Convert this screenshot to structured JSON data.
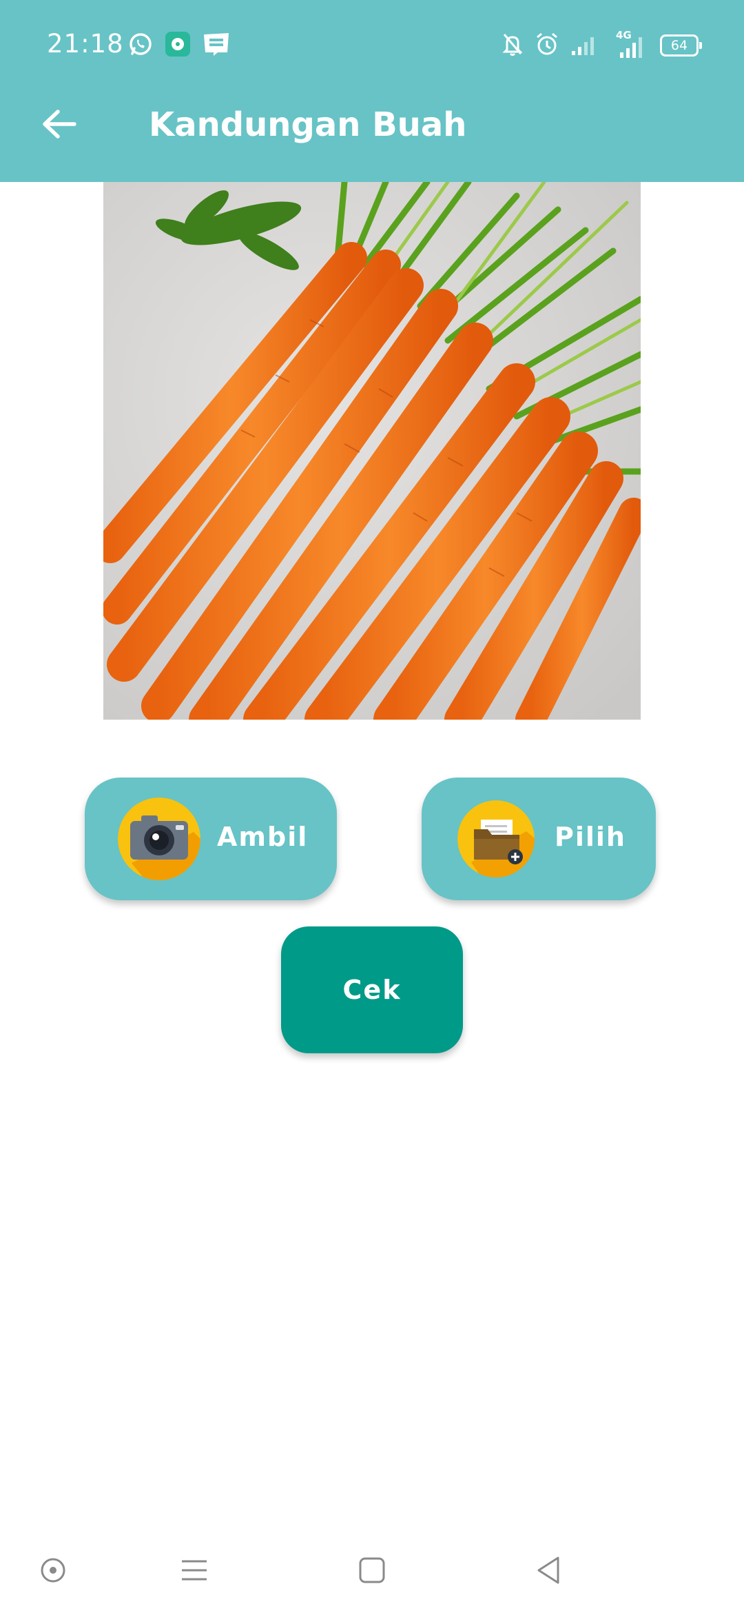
{
  "status_bar": {
    "time": "21:18",
    "network_label": "4G",
    "battery_level": "64",
    "left_icons": [
      "whatsapp-icon",
      "chat-app-icon",
      "webtoon-icon"
    ],
    "right_icons": [
      "notifications-off-icon",
      "alarm-icon",
      "signal-icon",
      "signal-4g-icon",
      "battery-icon"
    ]
  },
  "app_bar": {
    "title": "Kandungan Buah",
    "back_icon": "arrow-left-icon"
  },
  "image": {
    "subject": "carrots-photo"
  },
  "actions": {
    "ambil_label": "Ambil",
    "ambil_icon": "camera-icon",
    "pilih_label": "Pilih",
    "pilih_icon": "folder-add-icon",
    "cek_label": "Cek"
  },
  "nav_bar": {
    "icons": [
      "assistant-icon",
      "menu-icon",
      "home-icon",
      "back-icon"
    ]
  },
  "colors": {
    "primary": "#67c3c6",
    "accent": "#009a88",
    "background": "#ffffff"
  }
}
